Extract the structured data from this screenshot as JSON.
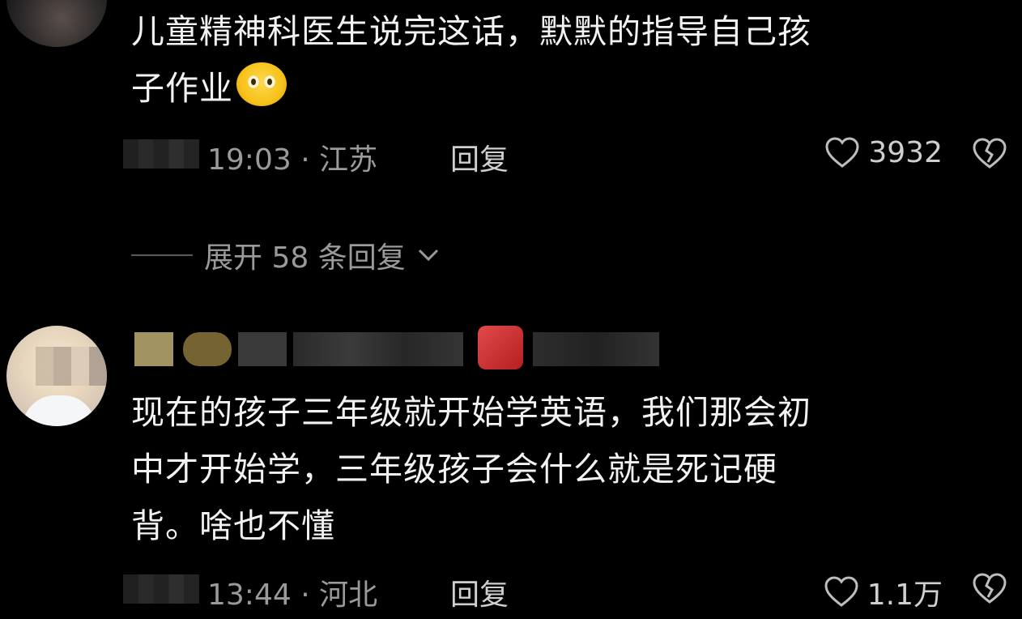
{
  "comments": [
    {
      "text_line1": "儿童精神科医生说完这话，默默的指导自己孩",
      "text_line2": "子作业",
      "emoji": "pleading-face-tears",
      "time": "19:03 · 江苏",
      "reply_label": "回复",
      "likes": "3932"
    },
    {
      "text_line1": "现在的孩子三年级就开始学英语，我们那会初",
      "text_line2": "中才开始学，三年级孩子会什么就是死记硬",
      "text_line3": "背。啥也不懂",
      "time": "13:44 · 河北",
      "reply_label": "回复",
      "likes": "1.1万"
    }
  ],
  "expand_replies": "展开 58 条回复",
  "colors": {
    "background": "#000000",
    "text": "#f2f2f2",
    "muted": "#9a9a9a"
  },
  "icons": [
    "heart-icon",
    "broken-heart-icon",
    "chevron-down-icon"
  ]
}
